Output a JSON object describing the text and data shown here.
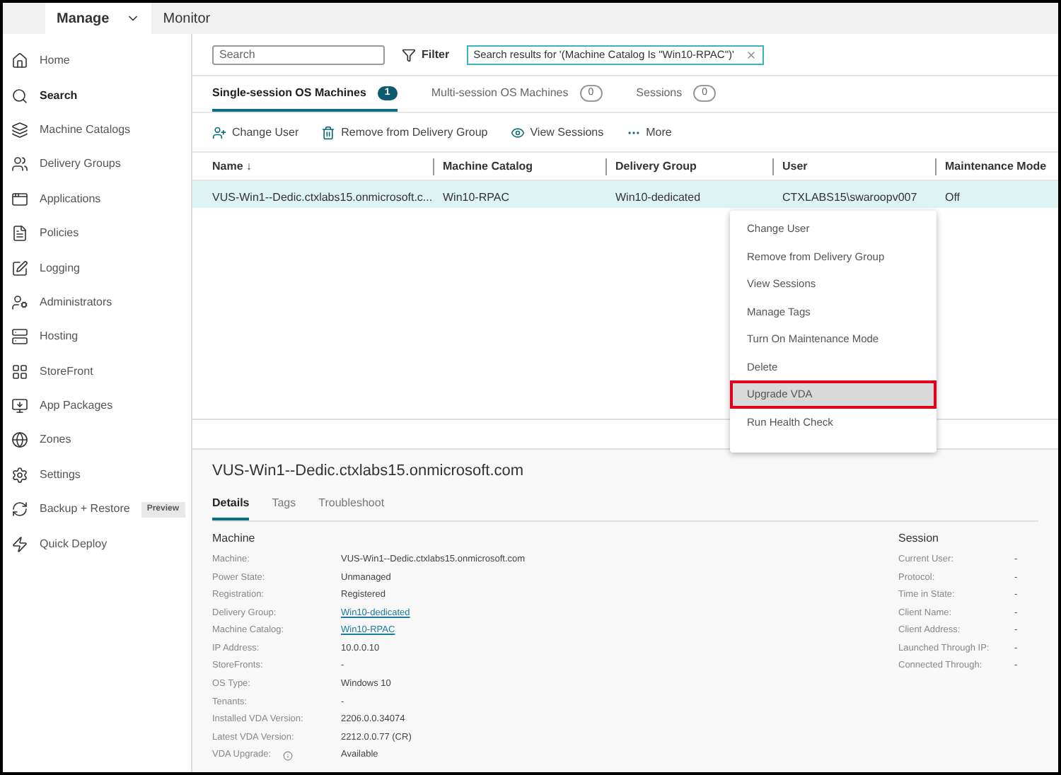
{
  "top_nav": [
    {
      "label": "Manage",
      "selected": true,
      "has_caret": true
    },
    {
      "label": "Monitor",
      "selected": false,
      "has_caret": false
    }
  ],
  "sidebar": {
    "items": [
      {
        "label": "Home",
        "selected": false
      },
      {
        "label": "Search",
        "selected": true
      },
      {
        "label": "Machine Catalogs",
        "selected": false
      },
      {
        "label": "Delivery Groups",
        "selected": false
      },
      {
        "label": "Applications",
        "selected": false
      },
      {
        "label": "Policies",
        "selected": false
      },
      {
        "label": "Logging",
        "selected": false
      },
      {
        "label": "Administrators",
        "selected": false
      },
      {
        "label": "Hosting",
        "selected": false
      },
      {
        "label": "StoreFront",
        "selected": false
      },
      {
        "label": "App Packages",
        "selected": false
      },
      {
        "label": "Zones",
        "selected": false
      },
      {
        "label": "Settings",
        "selected": false
      },
      {
        "label": "Backup + Restore",
        "selected": false,
        "badge": "Preview"
      },
      {
        "label": "Quick Deploy",
        "selected": false
      }
    ]
  },
  "search": {
    "placeholder": "Search"
  },
  "filter": {
    "label": "Filter",
    "chip": "Search results for '(Machine Catalog Is \"Win10-RPAC\")'"
  },
  "tabs": [
    {
      "label": "Single-session OS Machines",
      "count": "1",
      "selected": true
    },
    {
      "label": "Multi-session OS Machines",
      "count": "0",
      "selected": false
    },
    {
      "label": "Sessions",
      "count": "0",
      "selected": false
    }
  ],
  "toolbar": [
    {
      "label": "Change User",
      "kind": "user"
    },
    {
      "label": "Remove from Delivery Group",
      "kind": "trash"
    },
    {
      "label": "View Sessions",
      "kind": "eye"
    },
    {
      "label": "More",
      "kind": "more"
    }
  ],
  "table": {
    "columns": [
      "Name ↓",
      "Machine Catalog",
      "Delivery Group",
      "User",
      "Maintenance Mode"
    ],
    "rows": [
      {
        "selected": true,
        "cells": [
          "VUS-Win1--Dedic.ctxlabs15.onmicrosoft.c...",
          "Win10-RPAC",
          "Win10-dedicated",
          "CTXLABS15\\swaroopv007",
          "Off"
        ]
      }
    ]
  },
  "context_menu": [
    {
      "label": "Change User",
      "highlighted": false
    },
    {
      "label": "Remove from Delivery Group",
      "highlighted": false
    },
    {
      "label": "View Sessions",
      "highlighted": false
    },
    {
      "label": "Manage Tags",
      "highlighted": false
    },
    {
      "label": "Turn On Maintenance Mode",
      "highlighted": false
    },
    {
      "label": "Delete",
      "highlighted": false
    },
    {
      "label": "Upgrade VDA",
      "highlighted": true
    },
    {
      "label": "Run Health Check",
      "highlighted": false
    }
  ],
  "details": {
    "title": "VUS-Win1--Dedic.ctxlabs15.onmicrosoft.com",
    "tabs": [
      {
        "label": "Details",
        "selected": true
      },
      {
        "label": "Tags",
        "selected": false
      },
      {
        "label": "Troubleshoot",
        "selected": false
      }
    ],
    "machine": {
      "heading": "Machine",
      "fields": [
        {
          "label": "Machine:",
          "value": "VUS-Win1--Dedic.ctxlabs15.onmicrosoft.com",
          "link": false,
          "info": false
        },
        {
          "label": "Power State:",
          "value": "Unmanaged",
          "link": false,
          "info": false
        },
        {
          "label": "Registration:",
          "value": "Registered",
          "link": false,
          "info": false
        },
        {
          "label": "Delivery Group:",
          "value": "Win10-dedicated",
          "link": true,
          "info": false
        },
        {
          "label": "Machine Catalog:",
          "value": "Win10-RPAC",
          "link": true,
          "info": false
        },
        {
          "label": "IP Address:",
          "value": "10.0.0.10",
          "link": false,
          "info": false
        },
        {
          "label": "StoreFronts:",
          "value": "-",
          "link": false,
          "info": false
        },
        {
          "label": "OS Type:",
          "value": "Windows 10",
          "link": false,
          "info": false
        },
        {
          "label": "Tenants:",
          "value": "-",
          "link": false,
          "info": false
        },
        {
          "label": "Installed VDA Version:",
          "value": "2206.0.0.34074",
          "link": false,
          "info": false
        },
        {
          "label": "Latest VDA Version:",
          "value": "2212.0.0.77 (CR)",
          "link": false,
          "info": false
        },
        {
          "label": "VDA Upgrade:",
          "value": "Available",
          "link": false,
          "info": true
        }
      ]
    },
    "session": {
      "heading": "Session",
      "fields": [
        {
          "label": "Current User:",
          "value": "-"
        },
        {
          "label": "Protocol:",
          "value": "-"
        },
        {
          "label": "Time in State:",
          "value": "-"
        },
        {
          "label": "Client Name:",
          "value": "-"
        },
        {
          "label": "Client Address:",
          "value": "-"
        },
        {
          "label": "Launched Through IP:",
          "value": "-"
        },
        {
          "label": "Connected Through:",
          "value": "-"
        }
      ]
    }
  }
}
